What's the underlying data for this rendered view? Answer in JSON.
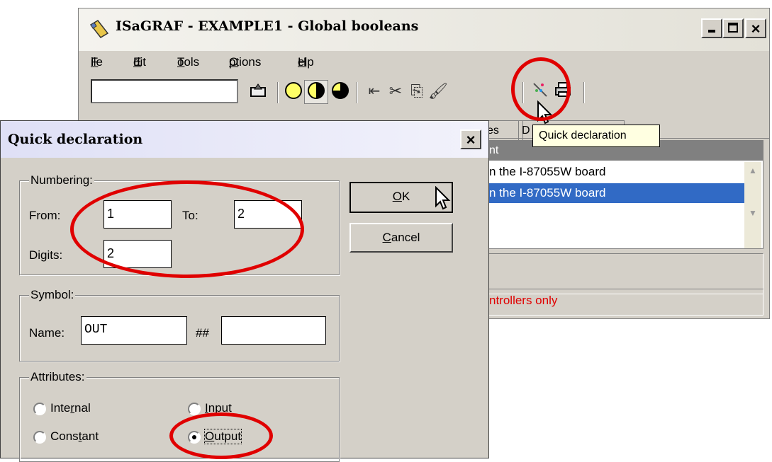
{
  "main_window": {
    "title": "ISaGRAF - EXAMPLE1 - Global booleans",
    "menu": [
      {
        "label": "File",
        "ul": "F",
        "rest": "ile"
      },
      {
        "label": "Edit",
        "ul": "E",
        "rest": "dit"
      },
      {
        "label": "Tools",
        "ul": "T",
        "rest": "ools"
      },
      {
        "label": "Options",
        "ul": "O",
        "rest": "ptions"
      },
      {
        "label": "Help",
        "ul": "H",
        "rest": "elp"
      }
    ],
    "tabs_partial": [
      "es",
      "D"
    ],
    "column_header_partial": "nt",
    "list_rows": [
      "n the I-87055W board",
      "n the I-87055W board"
    ],
    "status_note": "ntrollers only",
    "tooltip": "Quick declaration",
    "icons": [
      "window-icon",
      "minimize-icon",
      "maximize-icon",
      "close-icon",
      "open-icon",
      "circle-yellow-icon",
      "circle-half-icon",
      "circle-pie-icon",
      "indent-icon",
      "cut-icon",
      "copy-icon",
      "brush-icon",
      "quick-declaration-icon",
      "print-icon"
    ]
  },
  "dialog": {
    "title": "Quick declaration",
    "numbering": {
      "label": "Numbering:",
      "from_label": "From:",
      "from_value": "1",
      "to_label": "To:",
      "to_value": "2",
      "digits_label": "Digits:",
      "digits_value": "2"
    },
    "symbol": {
      "label": "Symbol:",
      "name_label": "Name:",
      "name_value": "OUT",
      "hash_label": "##",
      "suffix_value": ""
    },
    "attributes": {
      "label": "Attributes:",
      "options": [
        {
          "pre": "Inte",
          "ul": "r",
          "post": "nal",
          "selected": false
        },
        {
          "pre": "",
          "ul": "I",
          "post": "nput",
          "selected": false
        },
        {
          "pre": "Cons",
          "ul": "t",
          "post": "ant",
          "selected": false
        },
        {
          "pre": "",
          "ul": "O",
          "post": "utput",
          "selected": true
        }
      ]
    },
    "ok": {
      "ul": "O",
      "rest": "K"
    },
    "cancel": {
      "ul": "C",
      "rest": "ancel"
    }
  },
  "colors": {
    "annotation_red": "#e00000",
    "selection_blue": "#316ac5",
    "warning_red": "#e00000"
  }
}
